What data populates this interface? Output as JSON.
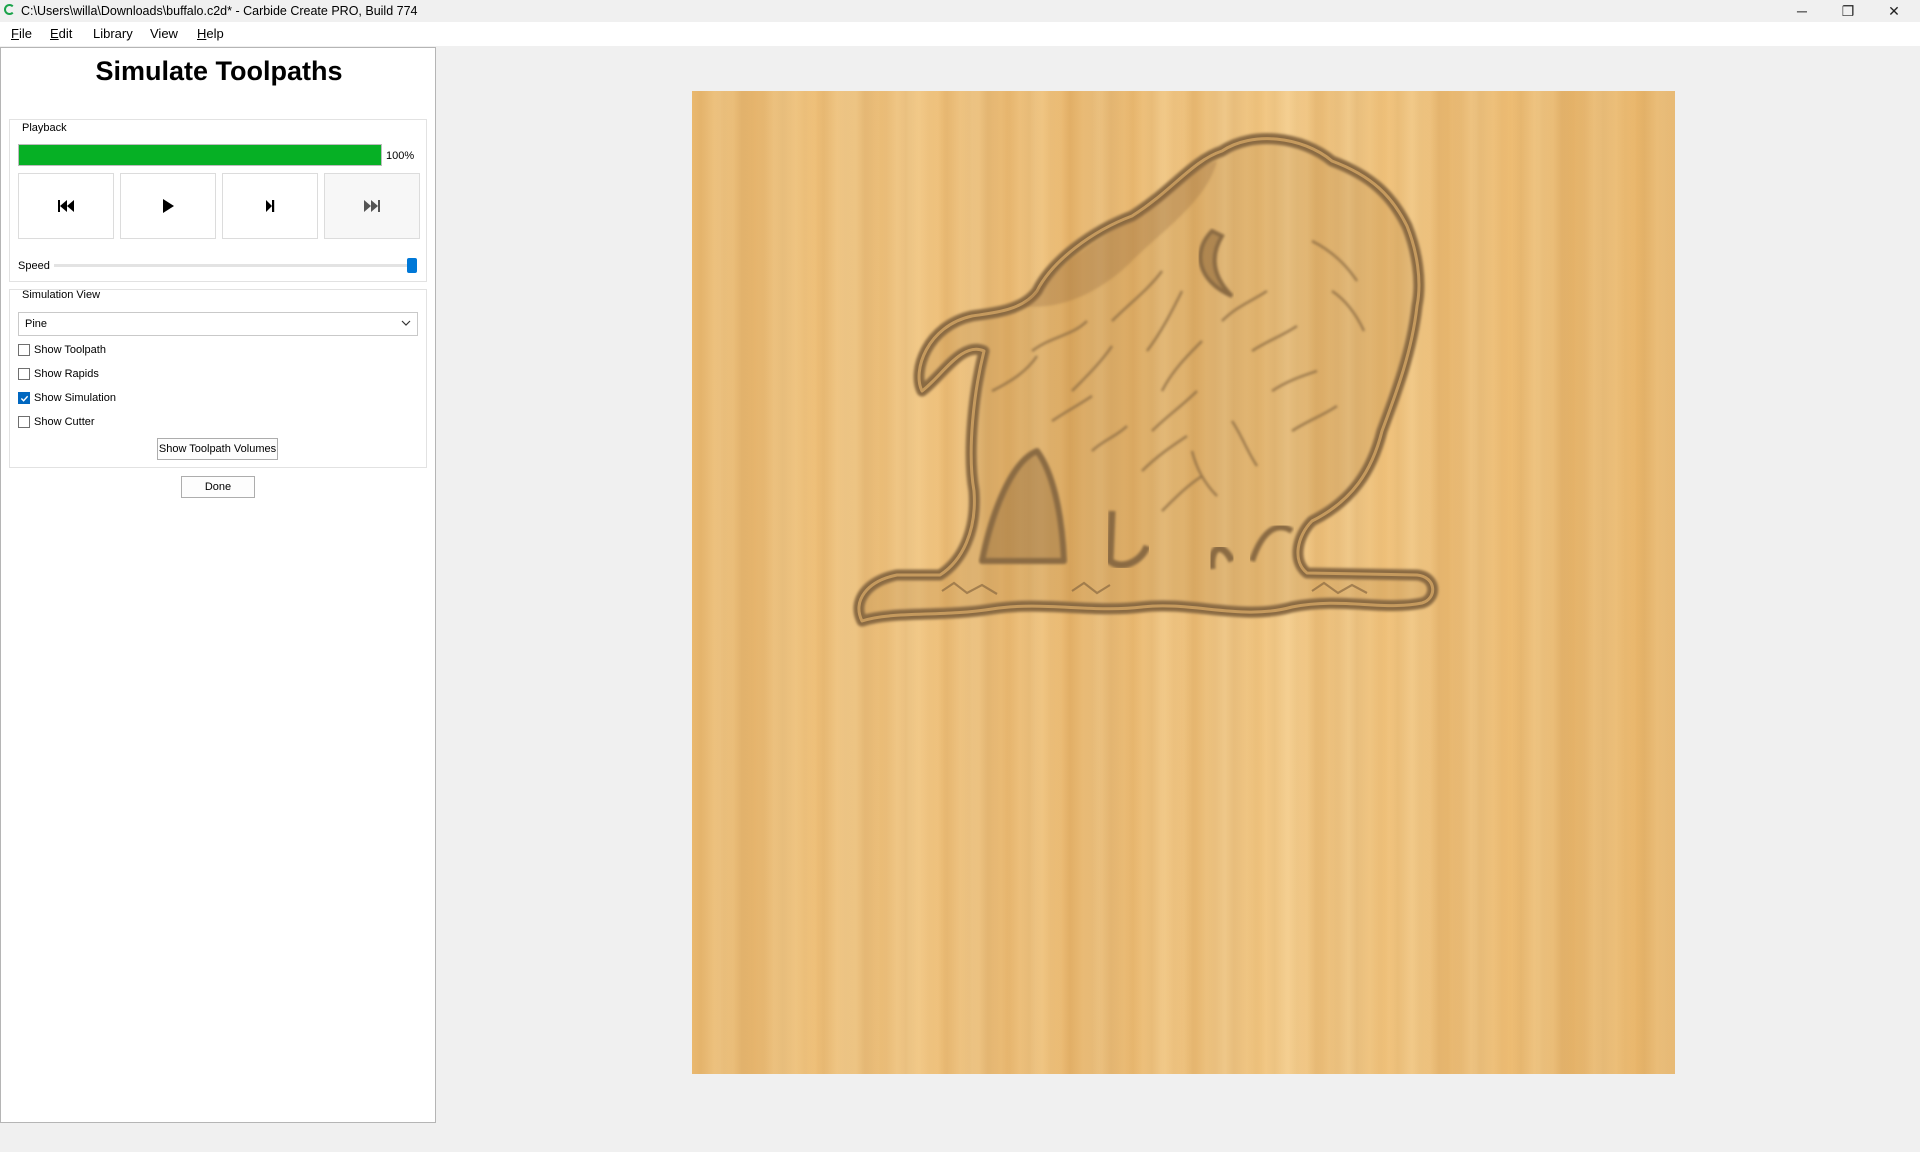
{
  "window": {
    "title": "C:\\Users\\willa\\Downloads\\buffalo.c2d* - Carbide Create PRO, Build 774",
    "controls": {
      "minimize": "─",
      "restore": "❐",
      "close": "✕"
    }
  },
  "menu": {
    "items": [
      {
        "mnemonic": "F",
        "rest": "ile"
      },
      {
        "mnemonic": "E",
        "rest": "dit"
      },
      {
        "mnemonic": "",
        "rest": "Library"
      },
      {
        "mnemonic": "",
        "rest": "View"
      },
      {
        "mnemonic": "H",
        "rest": "elp"
      }
    ]
  },
  "panel": {
    "title": "Simulate Toolpaths",
    "playback": {
      "label": "Playback",
      "progress_percent": 100,
      "progress_text": "100%",
      "buttons": [
        "skip-to-start-icon",
        "play-icon",
        "step-forward-icon",
        "skip-to-end-icon"
      ]
    },
    "speed": {
      "label": "Speed",
      "value_fraction": 1.0
    },
    "simulation_view": {
      "label": "Simulation View",
      "material": "Pine",
      "checks": [
        {
          "label": "Show Toolpath",
          "checked": false
        },
        {
          "label": "Show Rapids",
          "checked": false
        },
        {
          "label": "Show Simulation",
          "checked": true
        },
        {
          "label": "Show Cutter",
          "checked": false
        }
      ],
      "volumes_button": "Show Toolpath Volumes"
    },
    "done_button": "Done"
  },
  "colors": {
    "progress": "#06b025",
    "accent": "#0067c0",
    "wood": "#f0c27c",
    "carve": "#8a6a42"
  }
}
